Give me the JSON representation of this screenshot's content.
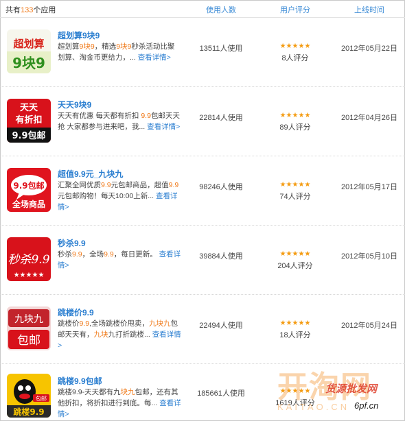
{
  "header": {
    "total_prefix": "共有",
    "total_count": "133",
    "total_suffix": "个应用",
    "col_users": "使用人数",
    "col_rating": "用户评分",
    "col_date": "上线时间"
  },
  "colors": {
    "link": "#2a7ed0",
    "highlight": "#f07a1a",
    "star": "#f49b10"
  },
  "apps": [
    {
      "name": "超划算9块9",
      "desc_parts": [
        "超划算",
        "9块9",
        "，精选",
        "9块9",
        "秒杀活动比聚划算、淘金币更给力，..."
      ],
      "more": "查看详情>",
      "users": "13511人使用",
      "stars": "★★★★★",
      "rating_count": "8人评分",
      "date": "2012年05月22日",
      "icon": "chaohuasuan-9kuai9-icon"
    },
    {
      "name": "天天9块9",
      "desc_parts": [
        "天天有优惠 每天都有折扣 ",
        "9.9",
        "包邮天天抢 大家都参与进来吧，我..."
      ],
      "more": "查看详情>",
      "users": "22814人使用",
      "stars": "★★★★★",
      "rating_count": "89人评分",
      "date": "2012年04月26日",
      "icon": "tiantian-youzhekou-icon"
    },
    {
      "name": "超值9.9元_九块九",
      "desc_parts": [
        "汇聚全网优质",
        "9.9",
        "元包邮商品，超值",
        "9.9",
        "元包邮购物！每天10:00上新..."
      ],
      "more": "查看详情>",
      "users": "98246人使用",
      "stars": "★★★★★",
      "rating_count": "74人评分",
      "date": "2012年05月17日",
      "icon": "99-baoyou-quanchang-icon"
    },
    {
      "name": "秒杀9.9",
      "desc_parts": [
        "秒杀",
        "9.9",
        "，全场",
        "9.9",
        "，每日更新。 "
      ],
      "more": "查看详情>",
      "users": "39884人使用",
      "stars": "★★★★★",
      "rating_count": "204人评分",
      "date": "2012年05月10日",
      "icon": "miaosha-99-icon"
    },
    {
      "name": "跳楼价9.9",
      "desc_parts": [
        "跳楼价",
        "9.9",
        ",全场跳楼价甩卖，",
        "九块九",
        "包邮天天有，",
        "九块",
        "九打折跳楼..."
      ],
      "more": "查看详情>",
      "users": "22494人使用",
      "stars": "★★★★★",
      "rating_count": "18人评分",
      "date": "2012年05月24日",
      "icon": "jiukuaijiu-baoyou-icon"
    },
    {
      "name": "跳楼9.9包邮",
      "desc_parts": [
        "跳楼9.9-天天都有九",
        "块九",
        "包邮，还有其他折扣，将折扣进行到底。每..."
      ],
      "more": "查看详情>",
      "users": "185661人使用",
      "stars": "★★★★★",
      "rating_count": "1619人评分",
      "date": "",
      "icon": "tiaolou-99-icon"
    }
  ],
  "icon_text": {
    "a1_top": "超划算",
    "a1_bottom": "9块9",
    "a2_line1": "天天",
    "a2_line2": "有折扣",
    "a2_line3": "9.9包邮",
    "a3_top": "9.9包邮",
    "a3_bottom": "全场商品",
    "a4_main": "秒杀9.9",
    "a5_top": "九块九",
    "a5_bottom": "包邮",
    "a6_tag": "包邮",
    "a6_bottom": "跳楼9.9"
  },
  "watermark": {
    "big": "开淘网",
    "sub": "货源批发网",
    "url": "KAITAO.CN",
    "url2": "6pf.cn"
  }
}
